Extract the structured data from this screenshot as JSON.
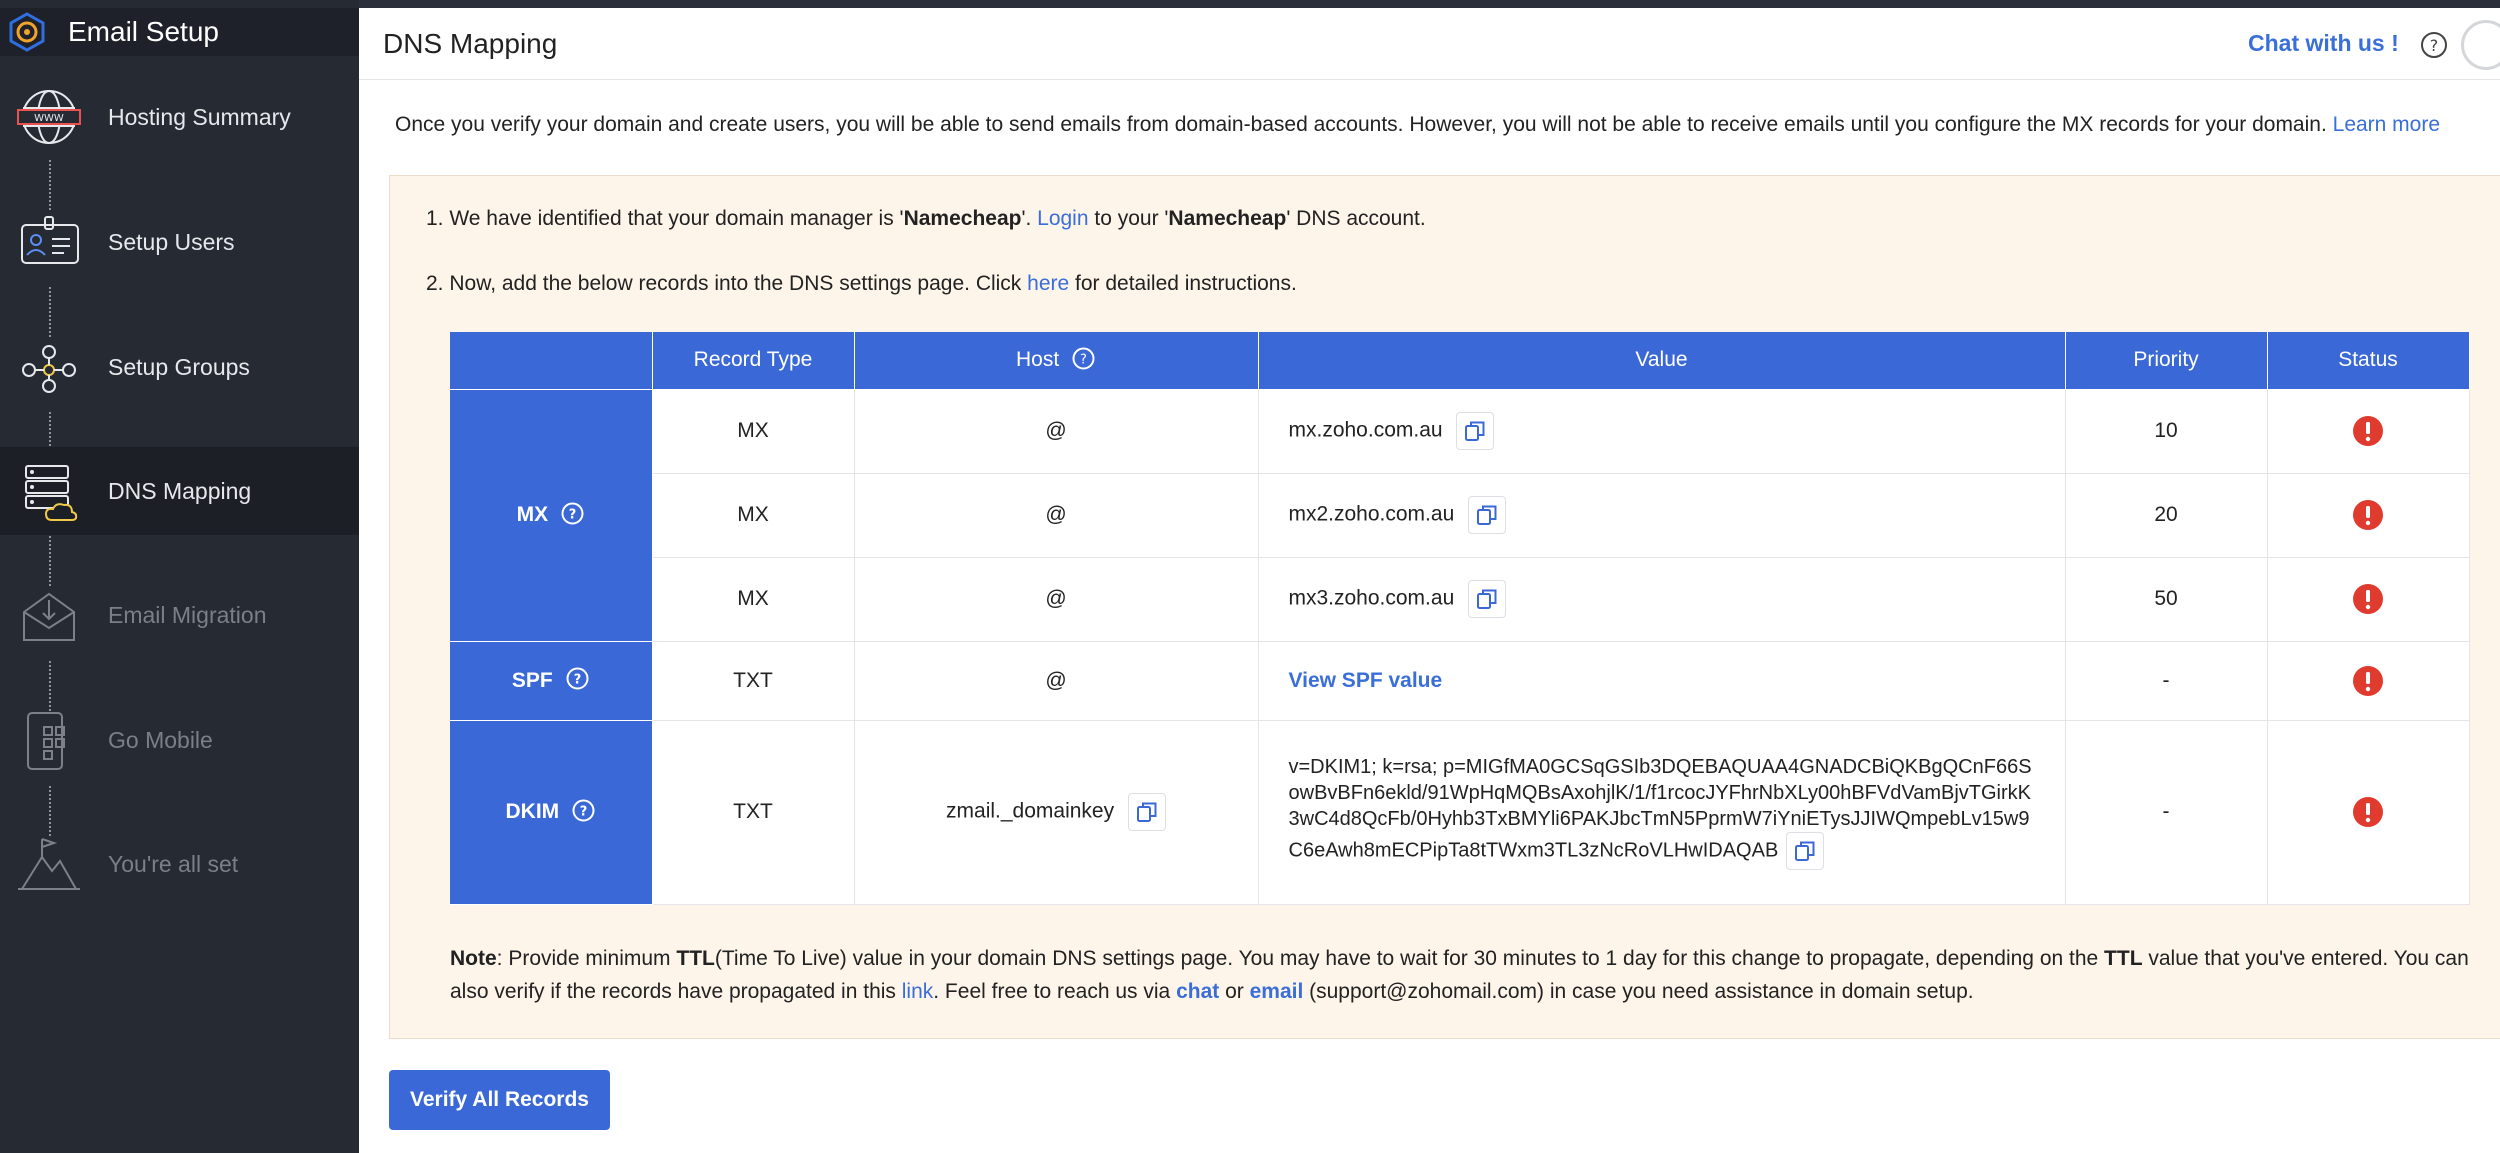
{
  "app": {
    "title": "Email Setup"
  },
  "sidebar": {
    "items": [
      {
        "label": "Hosting Summary",
        "icon": "globe-www-icon",
        "state": "done"
      },
      {
        "label": "Setup Users",
        "icon": "id-badge-icon",
        "state": "done"
      },
      {
        "label": "Setup Groups",
        "icon": "group-network-icon",
        "state": "done"
      },
      {
        "label": "DNS Mapping",
        "icon": "server-cloud-icon",
        "state": "active"
      },
      {
        "label": "Email Migration",
        "icon": "envelope-download-icon",
        "state": "disabled"
      },
      {
        "label": "Go Mobile",
        "icon": "mobile-apps-icon",
        "state": "disabled"
      },
      {
        "label": "You're all set",
        "icon": "mountain-flag-icon",
        "state": "disabled"
      }
    ]
  },
  "header": {
    "title": "DNS Mapping",
    "chat_label": "Chat with us !"
  },
  "intro": {
    "text": "Once you verify your domain and create users, you will be able to send emails from domain-based accounts. However, you will not be able to receive emails until you configure the MX records for your domain.",
    "learn_more": "Learn more"
  },
  "steps": {
    "step1": {
      "prefix": "1. We have identified that your domain manager is '",
      "manager": "Namecheap",
      "mid": "'. ",
      "login": "Login",
      "mid2": " to your '",
      "manager2": "Namecheap",
      "suffix": "' DNS account."
    },
    "step2": {
      "prefix": "2. Now, add the below records into the DNS settings page. Click ",
      "here": "here",
      "suffix": " for detailed instructions."
    }
  },
  "table": {
    "headers": [
      "Record Type",
      "Host",
      "Value",
      "Priority",
      "Status"
    ],
    "groups": {
      "mx": "MX",
      "spf": "SPF",
      "dkim": "DKIM"
    },
    "mx_rows": [
      {
        "type": "MX",
        "host": "@",
        "value": "mx.zoho.com.au",
        "priority": "10"
      },
      {
        "type": "MX",
        "host": "@",
        "value": "mx2.zoho.com.au",
        "priority": "20"
      },
      {
        "type": "MX",
        "host": "@",
        "value": "mx3.zoho.com.au",
        "priority": "50"
      }
    ],
    "spf_row": {
      "type": "TXT",
      "host": "@",
      "value": "View SPF value",
      "priority": "-"
    },
    "dkim_row": {
      "type": "TXT",
      "host": "zmail._domainkey",
      "value": "v=DKIM1; k=rsa; p=MIGfMA0GCSqGSIb3DQEBAQUAA4GNADCBiQKBgQCnF66SowBvBFn6ekld/91WpHqMQBsAxohjlK/1/f1rcocJYFhrNbXLy00hBFVdVamBjvTGirkK3wC4d8QcFb/0Hyhb3TxBMYli6PAKJbcTmN5PprmW7iYniETysJJIWQmpebLv15w9C6eAwh8mECPipTa8tTWxm3TL3zNcRoVLHwIDAQAB",
      "priority": "-"
    },
    "status_color": "#e03b2f"
  },
  "note": {
    "label": "Note",
    "t1": ": Provide minimum ",
    "ttl": "TTL",
    "t2": "(Time To Live) value in your domain DNS settings page. You may have to wait for 30 minutes to 1 day for this change to propagate, depending on the ",
    "ttl2": "TTL",
    "t3": " value that you've entered. You can also verify if the records have propagated in this ",
    "link": "link",
    "t4": ". Feel free to reach us via ",
    "chat": "chat",
    "t5": " or ",
    "email": "email",
    "t6": " (support@zohomail.com) in case you need assistance in domain setup."
  },
  "actions": {
    "verify_label": "Verify All Records"
  },
  "colors": {
    "accent": "#3a68d6",
    "link": "#3a6ed8",
    "sidebar_bg": "#262a33",
    "panel_bg": "#fdf4ea"
  }
}
